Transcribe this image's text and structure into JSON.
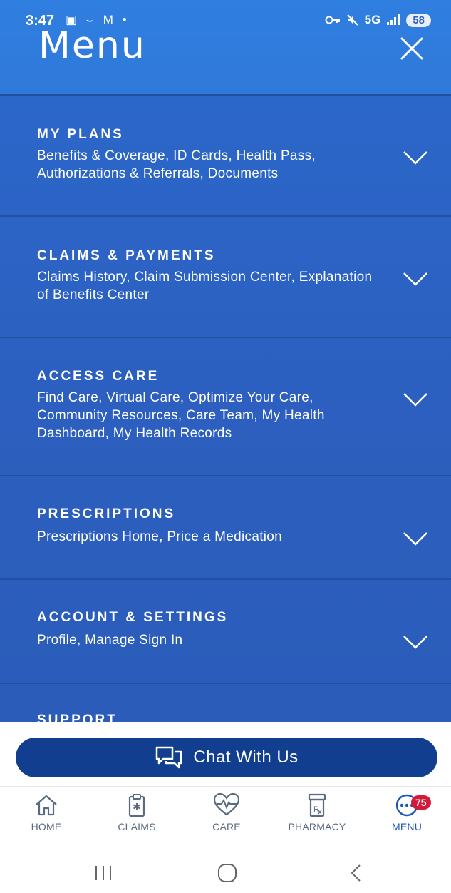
{
  "status_bar": {
    "time": "3:47",
    "left_icons": "▣ ⌣ M •",
    "network": "5G",
    "battery": "58"
  },
  "header": {
    "title": "Menu"
  },
  "sections": [
    {
      "title": "MY PLANS",
      "description": "Benefits & Coverage, ID Cards, Health Pass, Authorizations & Referrals, Documents"
    },
    {
      "title": "CLAIMS & PAYMENTS",
      "description": "Claims History, Claim Submission Center, Explanation of Benefits Center"
    },
    {
      "title": "ACCESS CARE",
      "description": "Find Care, Virtual Care, Optimize Your Care, Community Resources, Care Team, My Health Dashboard, My Health Records"
    },
    {
      "title": "PRESCRIPTIONS",
      "description": "Prescriptions Home, Price a Medication"
    },
    {
      "title": "ACCOUNT & SETTINGS",
      "description": "Profile, Manage Sign In"
    },
    {
      "title": "SUPPORT",
      "description": ""
    }
  ],
  "chat": {
    "label": "Chat With Us"
  },
  "tabs": [
    {
      "label": "HOME",
      "icon": "home-icon"
    },
    {
      "label": "CLAIMS",
      "icon": "clipboard-icon"
    },
    {
      "label": "CARE",
      "icon": "heart-pulse-icon"
    },
    {
      "label": "PHARMACY",
      "icon": "pill-bottle-icon"
    },
    {
      "label": "MENU",
      "icon": "menu-dots-icon",
      "badge": "75",
      "active": true
    }
  ],
  "colors": {
    "header_blue": "#2f7fe0",
    "menu_blue": "#2c5fbf",
    "chat_button": "#123e8f",
    "active_tab": "#1f56b8",
    "badge": "#d4193b"
  }
}
